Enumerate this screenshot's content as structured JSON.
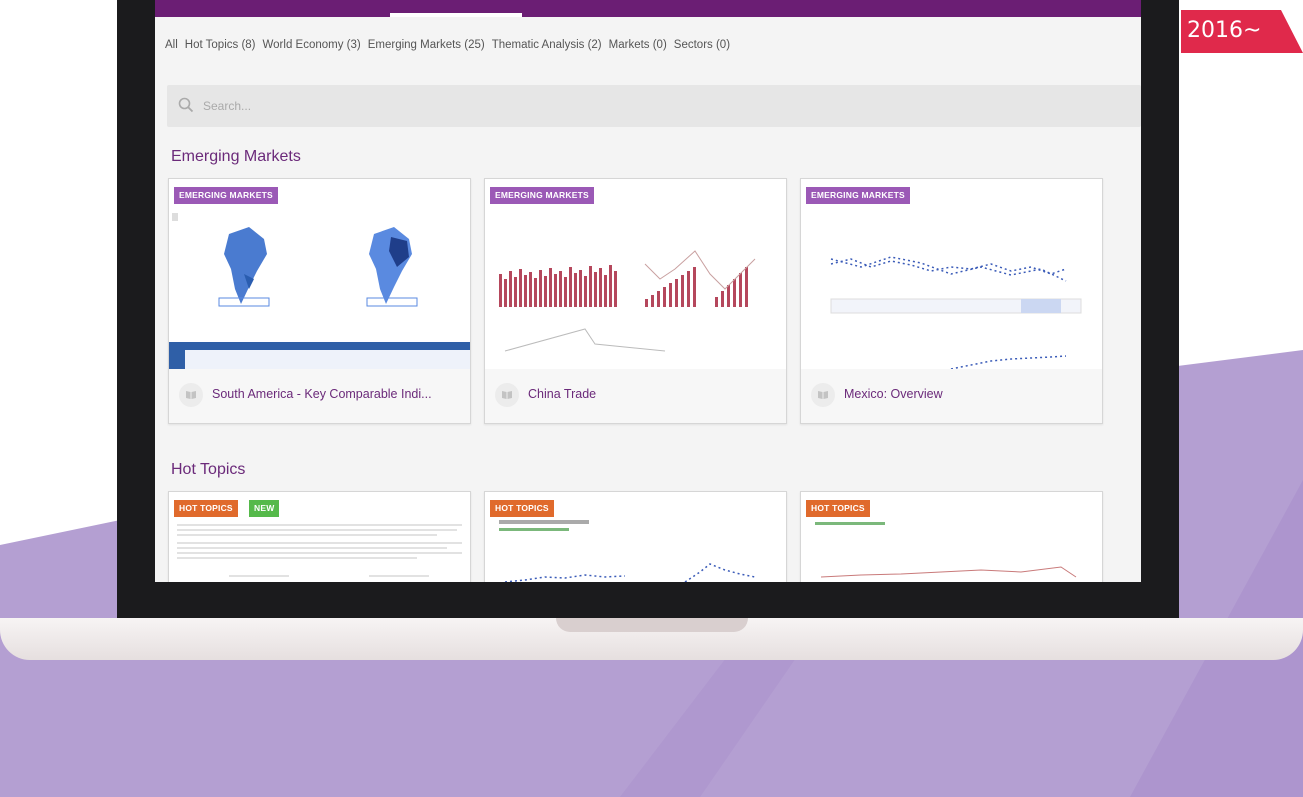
{
  "filters": [
    "All",
    "Hot Topics (8)",
    "World Economy (3)",
    "Emerging Markets (25)",
    "Thematic Analysis (2)",
    "Markets (0)",
    "Sectors (0)"
  ],
  "search": {
    "placeholder": "Search..."
  },
  "sections": {
    "emerging": {
      "title": "Emerging Markets",
      "cards": [
        {
          "badge": "EMERGING MARKETS",
          "title": "South America - Key Comparable Indi..."
        },
        {
          "badge": "EMERGING MARKETS",
          "title": "China Trade"
        },
        {
          "badge": "EMERGING MARKETS",
          "title": "Mexico: Overview"
        }
      ]
    },
    "hot": {
      "title": "Hot Topics",
      "cards": [
        {
          "badge": "HOT TOPICS",
          "extra_badge": "NEW"
        },
        {
          "badge": "HOT TOPICS"
        },
        {
          "badge": "HOT TOPICS"
        }
      ]
    }
  },
  "sticker": {
    "text": "2016~",
    "color": "#e0294b"
  },
  "colors": {
    "brand": "#6b1e74",
    "accent_purple": "#9b59b6",
    "hot_orange": "#e06a2c",
    "new_green": "#55b94a"
  }
}
